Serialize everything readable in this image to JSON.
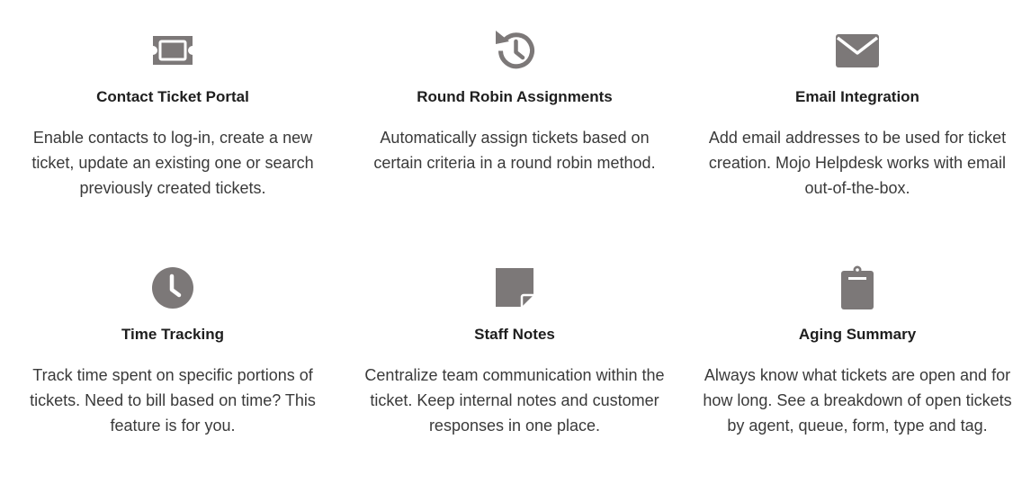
{
  "colors": {
    "icon": "#7c7878",
    "title": "#1e1e1e",
    "text": "#3a3a3a",
    "background": "#ffffff"
  },
  "features": [
    {
      "icon": "ticket-icon",
      "title": "Contact Ticket Portal",
      "description": "Enable contacts to log-in, create a new ticket, update an existing one or search previously created tickets."
    },
    {
      "icon": "history-icon",
      "title": "Round Robin Assignments",
      "description": "Automatically assign tickets based on certain criteria in a round robin method."
    },
    {
      "icon": "envelope-icon",
      "title": "Email Integration",
      "description": "Add email addresses to be used for ticket creation. Mojo Helpdesk works with email out-of-the-box."
    },
    {
      "icon": "clock-icon",
      "title": "Time Tracking",
      "description": "Track time spent on specific portions of tickets. Need to bill based on time? This feature is for you."
    },
    {
      "icon": "sticky-note-icon",
      "title": "Staff Notes",
      "description": "Centralize team communication within the ticket. Keep internal notes and customer responses in one place."
    },
    {
      "icon": "clipboard-icon",
      "title": "Aging Summary",
      "description": "Always know what tickets are open and for how long. See a breakdown of open tickets by agent, queue, form, type and tag."
    }
  ]
}
